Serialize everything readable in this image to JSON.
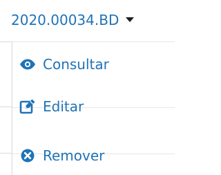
{
  "dropdown": {
    "title": "2020.00034.BD",
    "caret_icon": "caret-down-icon",
    "items": [
      {
        "label": "Consultar",
        "icon": "eye-icon"
      },
      {
        "label": "Editar",
        "icon": "edit-icon"
      },
      {
        "label": "Remover",
        "icon": "remove-circle-icon"
      }
    ]
  },
  "colors": {
    "accent": "#1f73b7",
    "background": "#ffffff",
    "border": "#dcdcdc"
  }
}
